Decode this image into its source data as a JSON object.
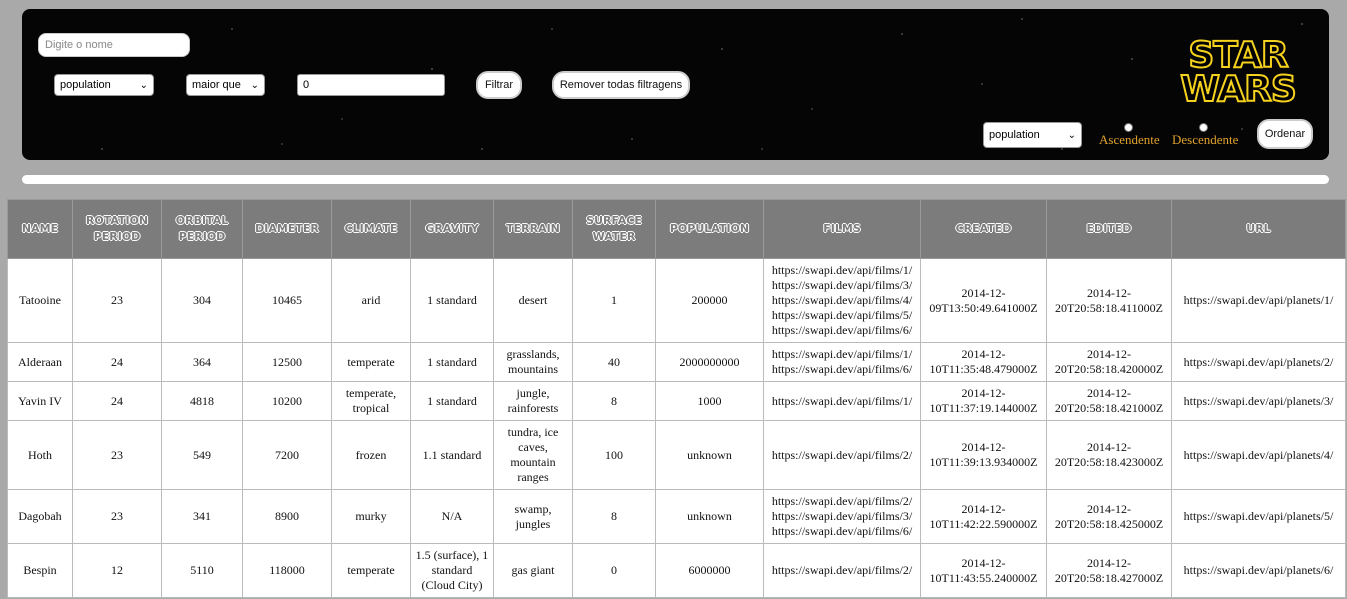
{
  "filters": {
    "name_placeholder": "Digite o nome",
    "column_select": "population",
    "comparison_select": "maior que",
    "value": "0",
    "filter_button": "Filtrar",
    "remove_button": "Remover todas filtragens"
  },
  "sort": {
    "column_select": "population",
    "asc_label": "Ascendente",
    "desc_label": "Descendente",
    "sort_button": "Ordenar"
  },
  "logo": {
    "line1": "STAR",
    "line2": "WARS"
  },
  "table": {
    "headers": [
      "name",
      "rotation period",
      "orbital period",
      "diameter",
      "climate",
      "gravity",
      "terrain",
      "surface water",
      "population",
      "films",
      "created",
      "edited",
      "url"
    ],
    "rows": [
      [
        "Tatooine",
        "23",
        "304",
        "10465",
        "arid",
        "1 standard",
        "desert",
        "1",
        "200000",
        "https://swapi.dev/api/films/1/\nhttps://swapi.dev/api/films/3/\nhttps://swapi.dev/api/films/4/\nhttps://swapi.dev/api/films/5/\nhttps://swapi.dev/api/films/6/",
        "2014-12-09T13:50:49.641000Z",
        "2014-12-20T20:58:18.411000Z",
        "https://swapi.dev/api/planets/1/"
      ],
      [
        "Alderaan",
        "24",
        "364",
        "12500",
        "temperate",
        "1 standard",
        "grasslands, mountains",
        "40",
        "2000000000",
        "https://swapi.dev/api/films/1/\nhttps://swapi.dev/api/films/6/",
        "2014-12-10T11:35:48.479000Z",
        "2014-12-20T20:58:18.420000Z",
        "https://swapi.dev/api/planets/2/"
      ],
      [
        "Yavin IV",
        "24",
        "4818",
        "10200",
        "temperate, tropical",
        "1 standard",
        "jungle, rainforests",
        "8",
        "1000",
        "https://swapi.dev/api/films/1/",
        "2014-12-10T11:37:19.144000Z",
        "2014-12-20T20:58:18.421000Z",
        "https://swapi.dev/api/planets/3/"
      ],
      [
        "Hoth",
        "23",
        "549",
        "7200",
        "frozen",
        "1.1 standard",
        "tundra, ice caves, mountain ranges",
        "100",
        "unknown",
        "https://swapi.dev/api/films/2/",
        "2014-12-10T11:39:13.934000Z",
        "2014-12-20T20:58:18.423000Z",
        "https://swapi.dev/api/planets/4/"
      ],
      [
        "Dagobah",
        "23",
        "341",
        "8900",
        "murky",
        "N/A",
        "swamp, jungles",
        "8",
        "unknown",
        "https://swapi.dev/api/films/2/\nhttps://swapi.dev/api/films/3/\nhttps://swapi.dev/api/films/6/",
        "2014-12-10T11:42:22.590000Z",
        "2014-12-20T20:58:18.425000Z",
        "https://swapi.dev/api/planets/5/"
      ],
      [
        "Bespin",
        "12",
        "5110",
        "118000",
        "temperate",
        "1.5 (surface), 1 standard (Cloud City)",
        "gas giant",
        "0",
        "6000000",
        "https://swapi.dev/api/films/2/",
        "2014-12-10T11:43:55.240000Z",
        "2014-12-20T20:58:18.427000Z",
        "https://swapi.dev/api/planets/6/"
      ]
    ]
  },
  "colors": {
    "header_bg": "#050505",
    "logo_yellow": "#f5d21e",
    "radio_label": "#e0a22b",
    "table_header_bg": "#7c7c7c",
    "page_bg": "#a9a9a9"
  }
}
